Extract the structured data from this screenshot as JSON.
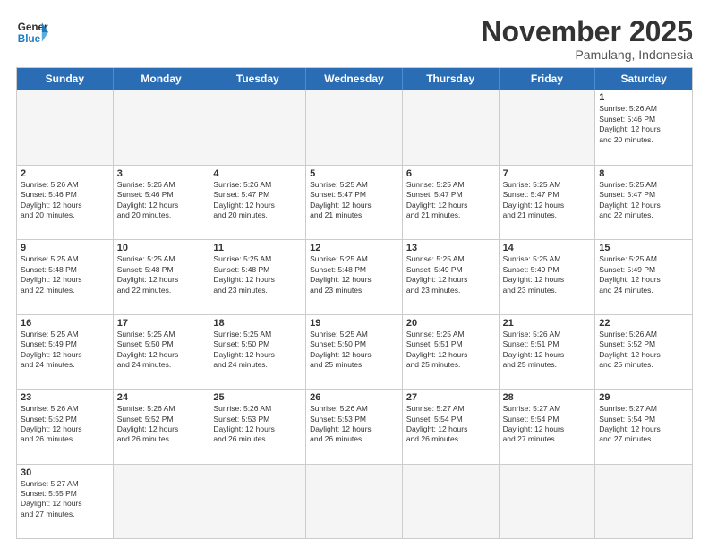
{
  "header": {
    "logo_general": "General",
    "logo_blue": "Blue",
    "month_title": "November 2025",
    "location": "Pamulang, Indonesia"
  },
  "day_names": [
    "Sunday",
    "Monday",
    "Tuesday",
    "Wednesday",
    "Thursday",
    "Friday",
    "Saturday"
  ],
  "weeks": [
    [
      {
        "day": "",
        "empty": true,
        "info": ""
      },
      {
        "day": "",
        "empty": true,
        "info": ""
      },
      {
        "day": "",
        "empty": true,
        "info": ""
      },
      {
        "day": "",
        "empty": true,
        "info": ""
      },
      {
        "day": "",
        "empty": true,
        "info": ""
      },
      {
        "day": "",
        "empty": true,
        "info": ""
      },
      {
        "day": "1",
        "empty": false,
        "info": "Sunrise: 5:26 AM\nSunset: 5:46 PM\nDaylight: 12 hours\nand 20 minutes."
      }
    ],
    [
      {
        "day": "2",
        "empty": false,
        "info": "Sunrise: 5:26 AM\nSunset: 5:46 PM\nDaylight: 12 hours\nand 20 minutes."
      },
      {
        "day": "3",
        "empty": false,
        "info": "Sunrise: 5:26 AM\nSunset: 5:46 PM\nDaylight: 12 hours\nand 20 minutes."
      },
      {
        "day": "4",
        "empty": false,
        "info": "Sunrise: 5:26 AM\nSunset: 5:47 PM\nDaylight: 12 hours\nand 20 minutes."
      },
      {
        "day": "5",
        "empty": false,
        "info": "Sunrise: 5:25 AM\nSunset: 5:47 PM\nDaylight: 12 hours\nand 21 minutes."
      },
      {
        "day": "6",
        "empty": false,
        "info": "Sunrise: 5:25 AM\nSunset: 5:47 PM\nDaylight: 12 hours\nand 21 minutes."
      },
      {
        "day": "7",
        "empty": false,
        "info": "Sunrise: 5:25 AM\nSunset: 5:47 PM\nDaylight: 12 hours\nand 21 minutes."
      },
      {
        "day": "8",
        "empty": false,
        "info": "Sunrise: 5:25 AM\nSunset: 5:47 PM\nDaylight: 12 hours\nand 22 minutes."
      }
    ],
    [
      {
        "day": "9",
        "empty": false,
        "info": "Sunrise: 5:25 AM\nSunset: 5:48 PM\nDaylight: 12 hours\nand 22 minutes."
      },
      {
        "day": "10",
        "empty": false,
        "info": "Sunrise: 5:25 AM\nSunset: 5:48 PM\nDaylight: 12 hours\nand 22 minutes."
      },
      {
        "day": "11",
        "empty": false,
        "info": "Sunrise: 5:25 AM\nSunset: 5:48 PM\nDaylight: 12 hours\nand 23 minutes."
      },
      {
        "day": "12",
        "empty": false,
        "info": "Sunrise: 5:25 AM\nSunset: 5:48 PM\nDaylight: 12 hours\nand 23 minutes."
      },
      {
        "day": "13",
        "empty": false,
        "info": "Sunrise: 5:25 AM\nSunset: 5:49 PM\nDaylight: 12 hours\nand 23 minutes."
      },
      {
        "day": "14",
        "empty": false,
        "info": "Sunrise: 5:25 AM\nSunset: 5:49 PM\nDaylight: 12 hours\nand 23 minutes."
      },
      {
        "day": "15",
        "empty": false,
        "info": "Sunrise: 5:25 AM\nSunset: 5:49 PM\nDaylight: 12 hours\nand 24 minutes."
      }
    ],
    [
      {
        "day": "16",
        "empty": false,
        "info": "Sunrise: 5:25 AM\nSunset: 5:49 PM\nDaylight: 12 hours\nand 24 minutes."
      },
      {
        "day": "17",
        "empty": false,
        "info": "Sunrise: 5:25 AM\nSunset: 5:50 PM\nDaylight: 12 hours\nand 24 minutes."
      },
      {
        "day": "18",
        "empty": false,
        "info": "Sunrise: 5:25 AM\nSunset: 5:50 PM\nDaylight: 12 hours\nand 24 minutes."
      },
      {
        "day": "19",
        "empty": false,
        "info": "Sunrise: 5:25 AM\nSunset: 5:50 PM\nDaylight: 12 hours\nand 25 minutes."
      },
      {
        "day": "20",
        "empty": false,
        "info": "Sunrise: 5:25 AM\nSunset: 5:51 PM\nDaylight: 12 hours\nand 25 minutes."
      },
      {
        "day": "21",
        "empty": false,
        "info": "Sunrise: 5:26 AM\nSunset: 5:51 PM\nDaylight: 12 hours\nand 25 minutes."
      },
      {
        "day": "22",
        "empty": false,
        "info": "Sunrise: 5:26 AM\nSunset: 5:52 PM\nDaylight: 12 hours\nand 25 minutes."
      }
    ],
    [
      {
        "day": "23",
        "empty": false,
        "info": "Sunrise: 5:26 AM\nSunset: 5:52 PM\nDaylight: 12 hours\nand 26 minutes."
      },
      {
        "day": "24",
        "empty": false,
        "info": "Sunrise: 5:26 AM\nSunset: 5:52 PM\nDaylight: 12 hours\nand 26 minutes."
      },
      {
        "day": "25",
        "empty": false,
        "info": "Sunrise: 5:26 AM\nSunset: 5:53 PM\nDaylight: 12 hours\nand 26 minutes."
      },
      {
        "day": "26",
        "empty": false,
        "info": "Sunrise: 5:26 AM\nSunset: 5:53 PM\nDaylight: 12 hours\nand 26 minutes."
      },
      {
        "day": "27",
        "empty": false,
        "info": "Sunrise: 5:27 AM\nSunset: 5:54 PM\nDaylight: 12 hours\nand 26 minutes."
      },
      {
        "day": "28",
        "empty": false,
        "info": "Sunrise: 5:27 AM\nSunset: 5:54 PM\nDaylight: 12 hours\nand 27 minutes."
      },
      {
        "day": "29",
        "empty": false,
        "info": "Sunrise: 5:27 AM\nSunset: 5:54 PM\nDaylight: 12 hours\nand 27 minutes."
      }
    ],
    [
      {
        "day": "30",
        "empty": false,
        "info": "Sunrise: 5:27 AM\nSunset: 5:55 PM\nDaylight: 12 hours\nand 27 minutes."
      },
      {
        "day": "",
        "empty": true,
        "info": ""
      },
      {
        "day": "",
        "empty": true,
        "info": ""
      },
      {
        "day": "",
        "empty": true,
        "info": ""
      },
      {
        "day": "",
        "empty": true,
        "info": ""
      },
      {
        "day": "",
        "empty": true,
        "info": ""
      },
      {
        "day": "",
        "empty": true,
        "info": ""
      }
    ]
  ]
}
